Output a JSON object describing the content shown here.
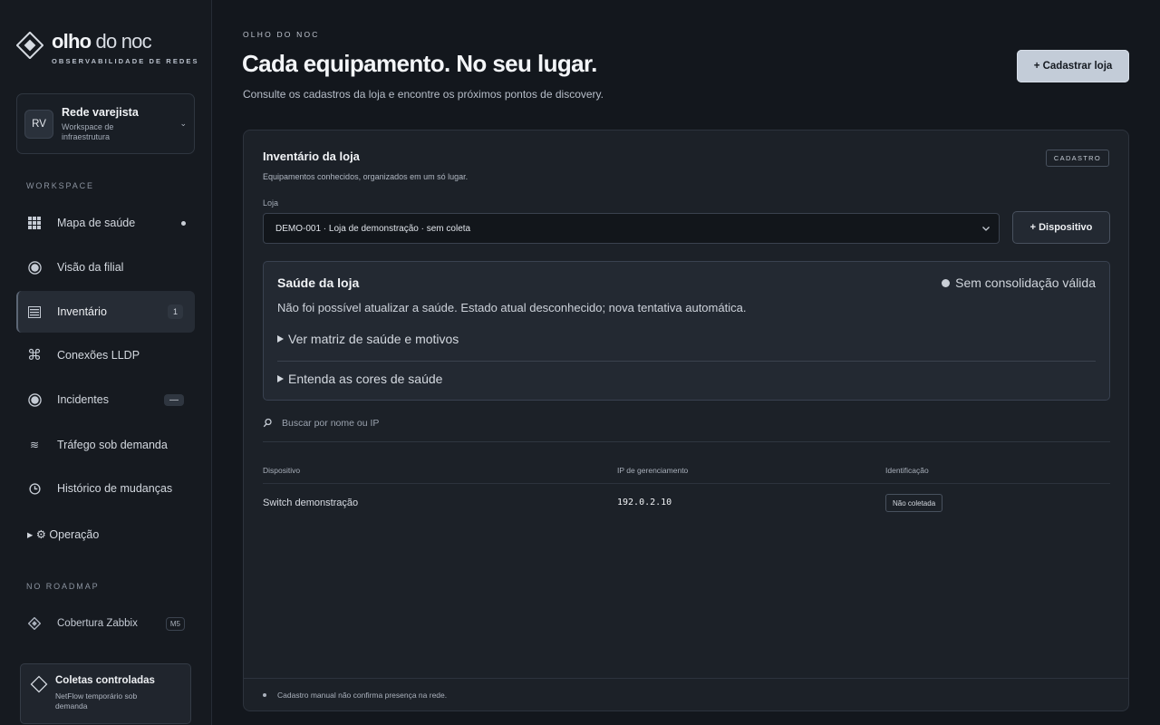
{
  "brand": {
    "name_bold": "olho",
    "name_light": " do noc",
    "tagline": "OBSERVABILIDADE DE REDES"
  },
  "workspace": {
    "initials": "RV",
    "title": "Rede varejista",
    "subtitle": "Workspace de infraestrutura"
  },
  "sidebar": {
    "section_workspace": "WORKSPACE",
    "items": [
      {
        "label": "Mapa de saúde",
        "icon": "grid-icon",
        "indicator": "dot"
      },
      {
        "label": "Visão da filial",
        "icon": "target-icon"
      },
      {
        "label": "Inventário",
        "icon": "list-icon",
        "badge": "1",
        "active": true
      },
      {
        "label": "Conexões LLDP",
        "icon": "command-icon"
      },
      {
        "label": "Incidentes",
        "icon": "target-icon",
        "badge": "—"
      },
      {
        "label": "Tráfego sob demanda",
        "icon": "wave-icon"
      },
      {
        "label": "Histórico de mudanças",
        "icon": "clock-icon"
      }
    ],
    "operation": "▸ ⚙ Operação",
    "section_roadmap": "NO ROADMAP",
    "roadmap_item": {
      "label": "Cobertura Zabbix",
      "badge": "M5",
      "icon": "diamond-icon"
    },
    "collect_card": {
      "title": "Coletas controladas",
      "subtitle": "NetFlow temporário sob demanda"
    }
  },
  "header": {
    "eyebrow": "OLHO DO NOC",
    "title": "Cada equipamento. No seu lugar.",
    "subtitle": "Consulte os cadastros da loja e encontre os próximos pontos de discovery.",
    "primary_button": "+ Cadastrar loja"
  },
  "panel": {
    "title": "Inventário da loja",
    "subtitle": "Equipamentos conhecidos, organizados em um só lugar.",
    "tag": "CADASTRO",
    "store_label": "Loja",
    "store_selected": "DEMO-001 · Loja de demonstração · sem coleta",
    "device_button": "+ Dispositivo",
    "health": {
      "title": "Saúde da loja",
      "status": "Sem consolidação válida",
      "message": "Não foi possível atualizar a saúde. Estado atual desconhecido; nova tentativa automática.",
      "details_1": "Ver matriz de saúde e motivos",
      "details_2": "Entenda as cores de saúde"
    },
    "search_placeholder": "Buscar por nome ou IP",
    "table": {
      "headers": [
        "Dispositivo",
        "IP de gerenciamento",
        "Identificação"
      ],
      "rows": [
        {
          "device": "Switch demonstração",
          "ip": "192.0.2.10",
          "identification": "Não coletada"
        }
      ]
    },
    "footer": "Cadastro manual não confirma presença na rede."
  }
}
